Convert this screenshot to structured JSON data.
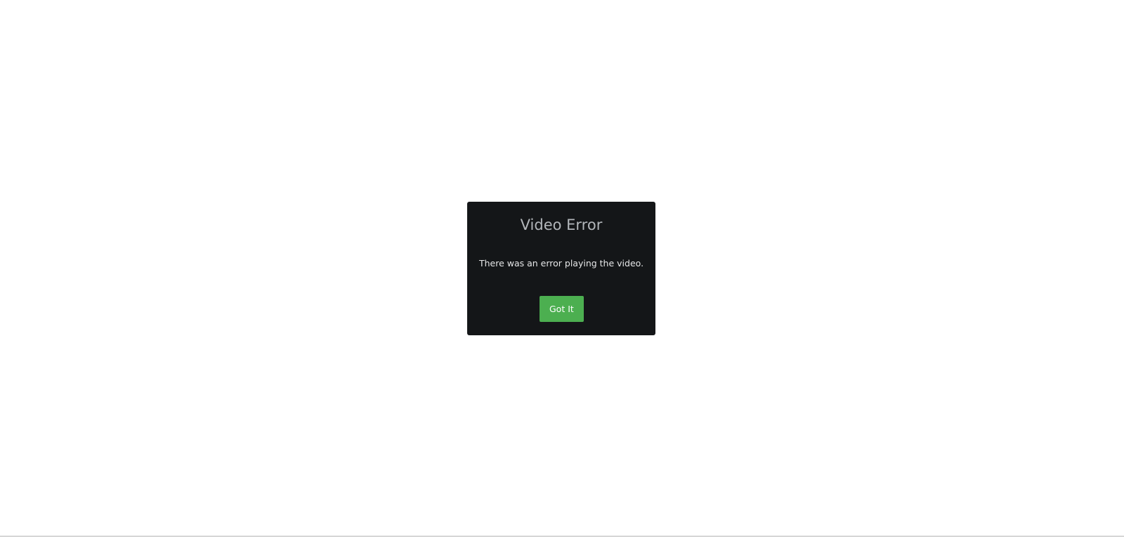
{
  "dialog": {
    "title": "Video Error",
    "message": "There was an error playing the video.",
    "button_label": "Got It"
  },
  "colors": {
    "page_background": "#ffffff",
    "dialog_background": "#141618",
    "title_text": "#b2b6ba",
    "message_text": "#e6e7e8",
    "button_background": "#4caf50",
    "button_text": "#ffffff"
  }
}
